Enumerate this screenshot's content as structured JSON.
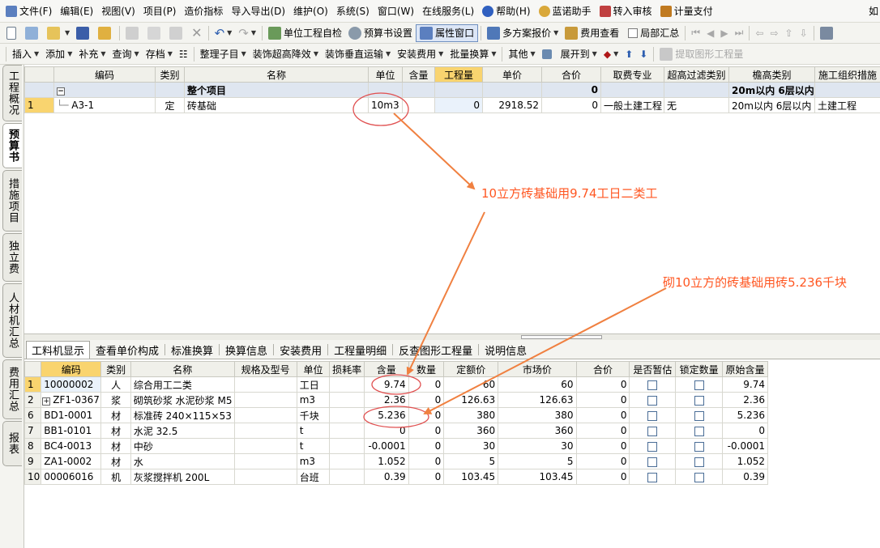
{
  "menubar": {
    "items": [
      {
        "label": "文件(F)",
        "icon": "file-icon",
        "color": "#5b7fbf"
      },
      {
        "label": "编辑(E)"
      },
      {
        "label": "视图(V)"
      },
      {
        "label": "项目(P)"
      },
      {
        "label": "造价指标"
      },
      {
        "label": "导入导出(D)"
      },
      {
        "label": "维护(O)"
      },
      {
        "label": "系统(S)"
      },
      {
        "label": "窗口(W)"
      },
      {
        "label": "在线服务(L)"
      },
      {
        "label": "帮助(H)",
        "icon": "help-icon",
        "color": "#3060c0"
      },
      {
        "label": "蓝诺助手",
        "icon": "helper-avatar-icon",
        "color": "#d9a83a"
      },
      {
        "label": "转入审核",
        "icon": "audit-icon",
        "color": "#c04040"
      },
      {
        "label": "计量支付",
        "icon": "payment-icon",
        "color": "#c07a20"
      }
    ],
    "tail": "如"
  },
  "toolbar1": {
    "unit_check": "单位工程自检",
    "budget_settings": "预算书设置",
    "attribute_window": "属性窗口",
    "multi_quote": "多方案报价",
    "fee_view": "费用查看",
    "partial_summary": "局部汇总"
  },
  "toolbar2": {
    "insert": "插入",
    "add": "添加",
    "supplement": "补充",
    "query": "查询",
    "storage": "存档",
    "organize": "整理子目",
    "decor_height": "装饰超高降效",
    "decor_transport": "装饰垂直运输",
    "install_fee": "安装费用",
    "batch_convert": "批量换算",
    "other": "其他",
    "expand": "展开到",
    "extract": "提取图形工程量"
  },
  "left_tabs": [
    "工程概况",
    "预算书",
    "措施项目",
    "独立费",
    "人材机汇总",
    "费用汇总",
    "报表"
  ],
  "upper_grid": {
    "headers": [
      "编码",
      "类别",
      "名称",
      "单位",
      "含量",
      "工程量",
      "单价",
      "合价",
      "取费专业",
      "超高过滤类别",
      "檐高类别",
      "施工组织措施"
    ],
    "group_row": {
      "name": "整个项目",
      "total": "0",
      "eave": "20m以内 6层以内"
    },
    "rows": [
      {
        "num": "1",
        "code": "A3-1",
        "type": "定",
        "name": "砖基础",
        "unit": "10m3",
        "content": "",
        "quantity": "0",
        "price": "2918.52",
        "total": "0",
        "fee_major": "一般土建工程",
        "filter": "无",
        "eave": "20m以内 6层以内",
        "measure": "土建工程"
      }
    ]
  },
  "bottom_tabs": [
    "工料机显示",
    "查看单价构成",
    "标准换算",
    "换算信息",
    "安装费用",
    "工程量明细",
    "反查图形工程量",
    "说明信息"
  ],
  "lower_grid": {
    "headers": [
      "编码",
      "类别",
      "名称",
      "规格及型号",
      "单位",
      "损耗率",
      "含量",
      "数量",
      "定额价",
      "市场价",
      "合价",
      "是否暂估",
      "锁定数量",
      "原始含量"
    ],
    "rows": [
      {
        "num": "1",
        "code": "10000002",
        "type": "人",
        "name": "综合用工二类",
        "unit": "工日",
        "content": "9.74",
        "qty": "0",
        "quota": "60",
        "market": "60",
        "total": "0",
        "orig": "9.74"
      },
      {
        "num": "2",
        "code": "ZF1-0367",
        "type": "浆",
        "name": "砌筑砂浆 水泥砂浆 M5",
        "unit": "m3",
        "content": "2.36",
        "qty": "0",
        "quota": "126.63",
        "market": "126.63",
        "total": "0",
        "orig": "2.36",
        "expander": "+"
      },
      {
        "num": "6",
        "code": "BD1-0001",
        "type": "材",
        "name": "标准砖 240×115×53",
        "unit": "千块",
        "content": "5.236",
        "qty": "0",
        "quota": "380",
        "market": "380",
        "total": "0",
        "orig": "5.236"
      },
      {
        "num": "7",
        "code": "BB1-0101",
        "type": "材",
        "name": "水泥 32.5",
        "unit": "t",
        "content": "0",
        "qty": "0",
        "quota": "360",
        "market": "360",
        "total": "0",
        "orig": "0"
      },
      {
        "num": "8",
        "code": "BC4-0013",
        "type": "材",
        "name": "中砂",
        "unit": "t",
        "content": "-0.0001",
        "qty": "0",
        "quota": "30",
        "market": "30",
        "total": "0",
        "orig": "-0.0001"
      },
      {
        "num": "9",
        "code": "ZA1-0002",
        "type": "材",
        "name": "水",
        "unit": "m3",
        "content": "1.052",
        "qty": "0",
        "quota": "5",
        "market": "5",
        "total": "0",
        "orig": "1.052"
      },
      {
        "num": "10",
        "code": "00006016",
        "type": "机",
        "name": "灰浆搅拌机 200L",
        "unit": "台班",
        "content": "0.39",
        "qty": "0",
        "quota": "103.45",
        "market": "103.45",
        "total": "0",
        "orig": "0.39"
      }
    ]
  },
  "annotations": {
    "note1": "10立方砖基础用9.74工日二类工",
    "note2": "砌10立方的砖基础用砖5.236千块",
    "color": "#ff5722"
  }
}
